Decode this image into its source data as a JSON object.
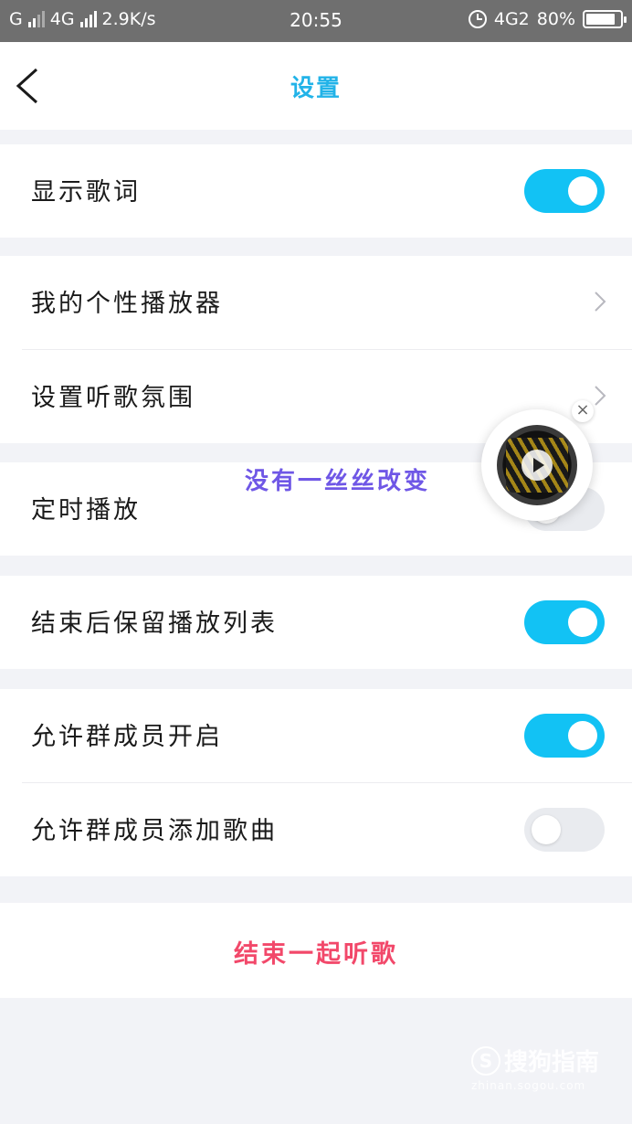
{
  "status_bar": {
    "carrier_left": "G",
    "network": "4G",
    "speed": "2.9K/s",
    "time": "20:55",
    "network_right": "4G2",
    "battery_percent": "80%",
    "battery_level": 0.8
  },
  "header": {
    "title": "设置",
    "back_icon": "chevron-left-icon"
  },
  "sections": [
    {
      "rows": [
        {
          "label": "显示歌词",
          "control": "toggle",
          "on": true
        }
      ]
    },
    {
      "rows": [
        {
          "label": "我的个性播放器",
          "control": "chevron"
        },
        {
          "label": "设置听歌氛围",
          "control": "chevron"
        }
      ]
    },
    {
      "rows": [
        {
          "label": "定时播放",
          "control": "toggle",
          "on": false
        }
      ]
    },
    {
      "rows": [
        {
          "label": "结束后保留播放列表",
          "control": "toggle",
          "on": true
        }
      ]
    },
    {
      "rows": [
        {
          "label": "允许群成员开启",
          "control": "toggle",
          "on": true
        },
        {
          "label": "允许群成员添加歌曲",
          "control": "toggle",
          "on": false
        }
      ]
    }
  ],
  "end_button": {
    "label": "结束一起听歌"
  },
  "overlay_caption": "没有一丝丝改变",
  "floating_player": {
    "close_symbol": "×",
    "icon": "music-disc-icon"
  },
  "watermark": {
    "text": "搜狗指南",
    "logo_letter": "S",
    "url": "zhinan.sogou.com"
  },
  "colors": {
    "accent": "#12c2f4",
    "title": "#22b3e8",
    "danger": "#f2486a",
    "caption": "#6f57e6"
  }
}
